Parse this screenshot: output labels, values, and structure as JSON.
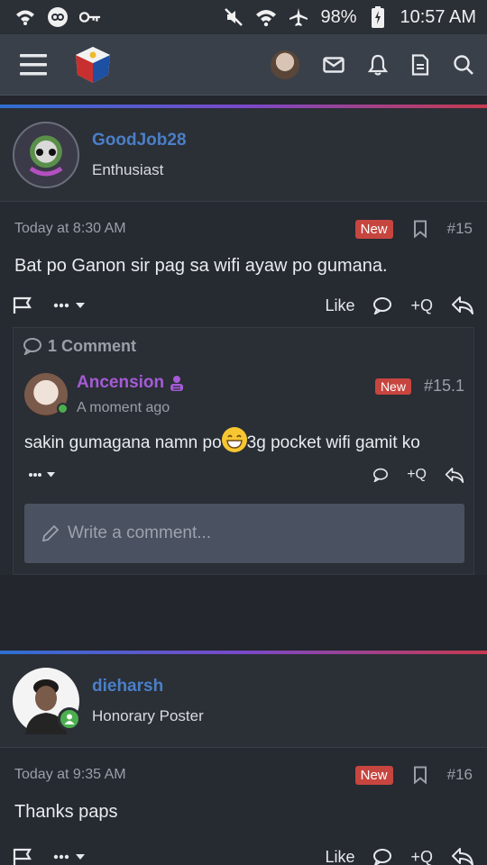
{
  "status_bar": {
    "battery": "98%",
    "time": "10:57 AM"
  },
  "colors": {
    "accent_blue": "#4a7fc7",
    "purple_name": "#a55bd6",
    "new_badge": "#c7453f",
    "gradient": [
      "#2f6fd0",
      "#7a49c9",
      "#c63a4f"
    ]
  },
  "posts": [
    {
      "username": "GoodJob28",
      "user_title": "Enthusiast",
      "timestamp": "Today at 8:30 AM",
      "badge": "New",
      "number": "#15",
      "body": "Bat po Ganon sir pag sa wifi ayaw po gumana.",
      "actions": {
        "like": "Like",
        "quote": "Q"
      },
      "comments": {
        "header": "1 Comment",
        "items": [
          {
            "username": "Ancension",
            "time": "A moment ago",
            "badge": "New",
            "number": "#15.1",
            "text_before": "sakin gumagana namn po",
            "text_after": "3g pocket wifi gamit ko",
            "quote": "Q"
          }
        ],
        "input_placeholder": "Write a comment..."
      }
    },
    {
      "username": "dieharsh",
      "user_title": "Honorary Poster",
      "timestamp": "Today at 9:35 AM",
      "badge": "New",
      "number": "#16",
      "body": "Thanks paps",
      "actions": {
        "like": "Like",
        "quote": "Q"
      }
    }
  ]
}
